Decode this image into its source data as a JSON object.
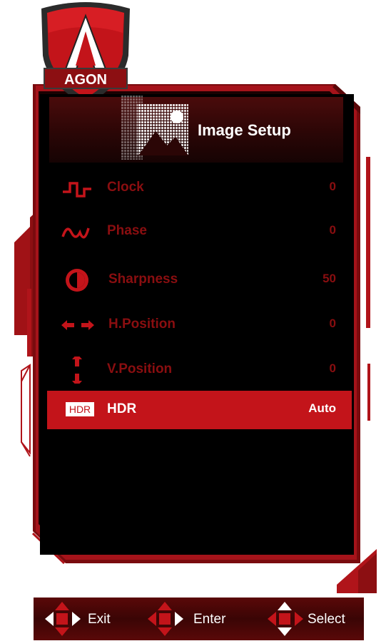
{
  "logo": {
    "text": "AGON"
  },
  "header": {
    "title": "Image Setup",
    "icon": "image-setup-icon"
  },
  "menu": [
    {
      "label": "Clock",
      "value": "0",
      "icon": "clock-wave-icon"
    },
    {
      "label": "Phase",
      "value": "0",
      "icon": "phase-wave-icon"
    },
    {
      "label": "Sharpness",
      "value": "50",
      "icon": "sharpness-icon"
    },
    {
      "label": "H.Position",
      "value": "0",
      "icon": "horizontal-arrows-icon"
    },
    {
      "label": "V.Position",
      "value": "0",
      "icon": "vertical-arrows-icon"
    },
    {
      "label": "HDR",
      "value": "Auto",
      "icon": "hdr-icon",
      "badge": "HDR",
      "selected": true
    }
  ],
  "footer": {
    "exit": "Exit",
    "enter": "Enter",
    "select": "Select"
  },
  "colors": {
    "accent": "#c3141a",
    "dim_text": "#8a0e10",
    "panel": "#000000",
    "frame": "#b0141a"
  }
}
